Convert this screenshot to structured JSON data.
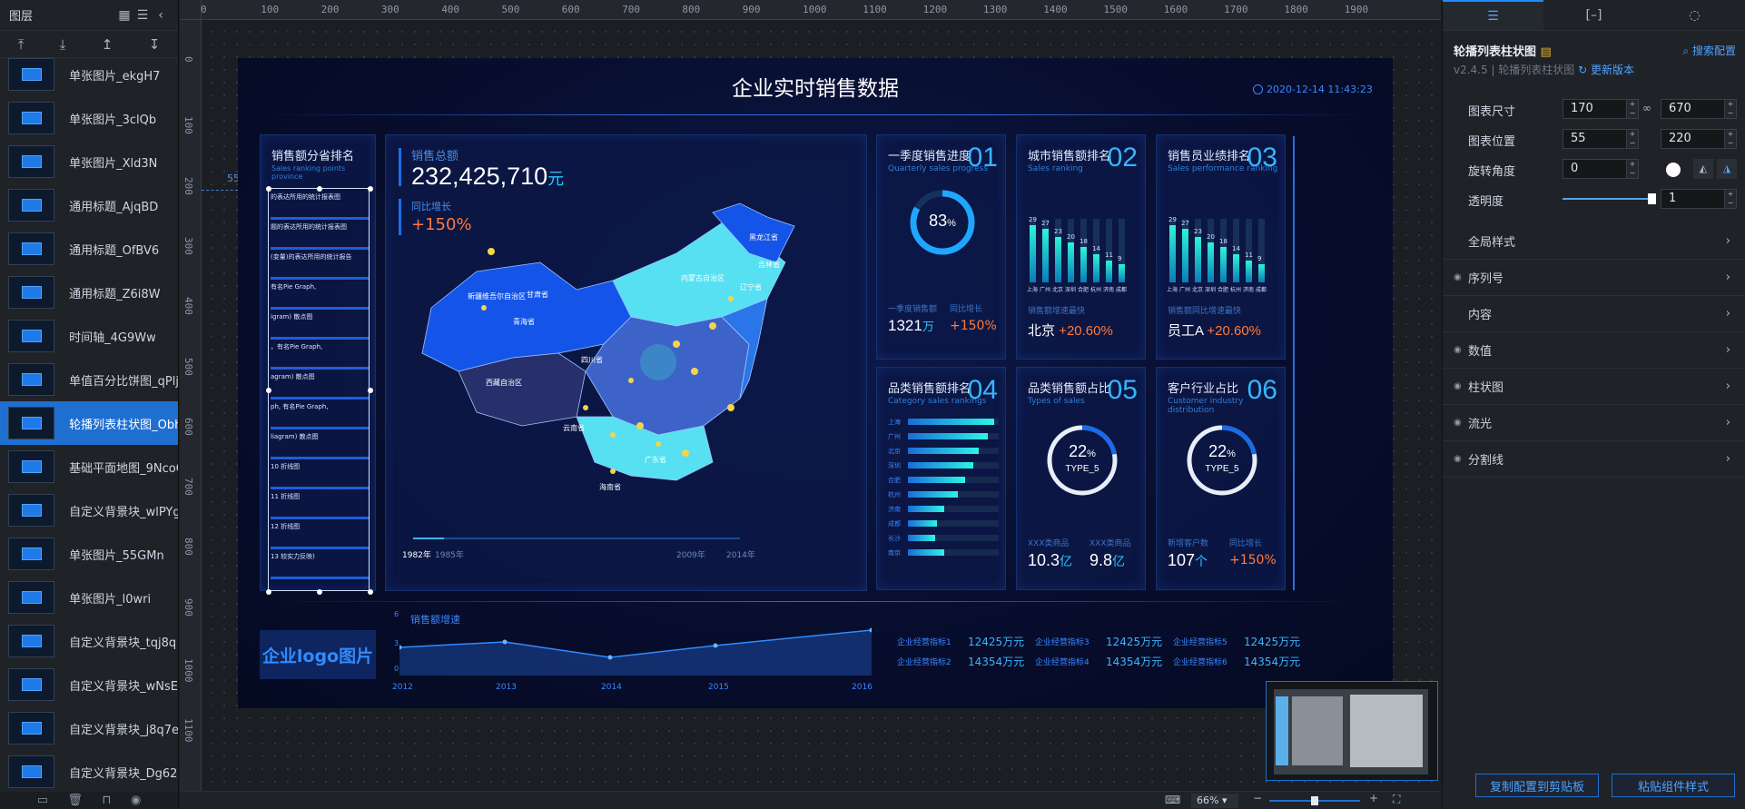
{
  "layers_panel": {
    "title": "图层",
    "items": [
      {
        "name": "单张图片_ekgH7"
      },
      {
        "name": "单张图片_3clQb"
      },
      {
        "name": "单张图片_Xld3N"
      },
      {
        "name": "通用标题_AjqBD"
      },
      {
        "name": "通用标题_OfBV6"
      },
      {
        "name": "通用标题_Z6i8W"
      },
      {
        "name": "时间轴_4G9Ww"
      },
      {
        "name": "单值百分比饼图_qPljX"
      },
      {
        "name": "轮播列表柱状图_Obhis"
      },
      {
        "name": "基础平面地图_9NcoO"
      },
      {
        "name": "自定义背景块_wlPYg"
      },
      {
        "name": "单张图片_55GMn"
      },
      {
        "name": "单张图片_l0wri"
      },
      {
        "name": "自定义背景块_tqj8q"
      },
      {
        "name": "自定义背景块_wNsE9"
      },
      {
        "name": "自定义背景块_j8q7e"
      },
      {
        "name": "自定义背景块_Dg62w"
      }
    ]
  },
  "ruler": {
    "h": [
      "0",
      "100",
      "200",
      "300",
      "400",
      "500",
      "600",
      "700",
      "800",
      "900",
      "1000",
      "1100",
      "1200",
      "1300",
      "1400",
      "1500",
      "1600",
      "1700",
      "1800",
      "1900"
    ],
    "v": [
      "0",
      "100",
      "200",
      "300",
      "400",
      "500",
      "600",
      "700",
      "800",
      "900",
      "1000",
      "1100"
    ],
    "pos_label": "55, 220"
  },
  "dashboard": {
    "title": "企业实时销售数据",
    "datetime": "2020-12-14 11:43:23",
    "rank": {
      "title": "销售额分省排名",
      "sub": "Sales ranking points province",
      "rows": [
        "的表达所用的统计报表图",
        "题的表达所用的统计报表图",
        "(变量)的表达所用的统计报告",
        "有名Pie Graph,",
        "igram)          散点图",
        "，有名Pie Graph,",
        "agram)          散点图",
        "ph, 有名Pie Graph,",
        "liagram)         散点图",
        "10    折线图",
        "11    折线图",
        "12    折线图",
        "13    较实力反映)"
      ]
    },
    "sales": {
      "label": "销售总额",
      "value": "232,425,710",
      "unit": "元",
      "growth_label": "同比增长",
      "growth": "+150%"
    },
    "map": {
      "timeline": [
        "1982年",
        "1985年",
        "2009年",
        "2014年"
      ],
      "regions": [
        "新疆维吾尔自治区",
        "甘肃省",
        "青海省",
        "西藏自治区",
        "内蒙古自治区",
        "黑龙江省",
        "吉林省",
        "辽宁省",
        "四川省",
        "云南省",
        "广东省",
        "海南省"
      ]
    },
    "c1": {
      "title": "一季度销售进度",
      "sub": "Quarterly sales progress",
      "num": "01",
      "pct": "83",
      "pct_unit": "%",
      "progress": 0.83,
      "s1_label": "一季度销售额",
      "s1_value": "1321",
      "s1_unit": "万",
      "s2_label": "同比增长",
      "s2_value": "+150%"
    },
    "c2": {
      "title": "城市销售额排名",
      "sub": "Sales ranking",
      "num": "02",
      "values": [
        "29",
        "27",
        "23",
        "20",
        "18",
        "14",
        "11",
        "9"
      ],
      "cats": [
        "上海",
        "广州",
        "北京",
        "深圳",
        "合肥",
        "杭州",
        "济南",
        "成都"
      ],
      "f_label": "销售额增速最快",
      "f_value": "北京",
      "f_pct": "+20.60%"
    },
    "c3": {
      "title": "销售员业绩排名",
      "sub": "Sales performance ranking",
      "num": "03",
      "values": [
        "29",
        "27",
        "23",
        "20",
        "18",
        "14",
        "11",
        "9"
      ],
      "cats": [
        "上海",
        "广州",
        "北京",
        "深圳",
        "合肥",
        "杭州",
        "济南",
        "成都"
      ],
      "f_label": "销售额同比增速最快",
      "f_value": "员工A",
      "f_pct": "+20.60%"
    },
    "c4": {
      "title": "品类销售额排名",
      "sub": "Category sales rankings",
      "num": "04",
      "cats": [
        "上海",
        "广州",
        "北京",
        "深圳",
        "合肥",
        "杭州",
        "济南",
        "成都",
        "长沙",
        "南京"
      ],
      "values": [
        0.95,
        0.88,
        0.78,
        0.72,
        0.63,
        0.55,
        0.4,
        0.32,
        0.3,
        0.4
      ]
    },
    "c5": {
      "title": "品类销售额占比",
      "sub": "Types of sales",
      "num": "05",
      "pct": "22",
      "pct_unit": "%",
      "type": "TYPE_5",
      "progress": 0.22,
      "s1_label": "XXX类商品",
      "s1_value": "10.3",
      "s1_unit": "亿",
      "s2_label": "XXX类商品",
      "s2_value": "9.8",
      "s2_unit": "亿"
    },
    "c6": {
      "title": "客户行业占比",
      "sub": "Customer industry distribution",
      "num": "06",
      "pct": "22",
      "pct_unit": "%",
      "type": "TYPE_5",
      "progress": 0.22,
      "s1_label": "新增客户数",
      "s1_value": "107",
      "s1_unit": "个",
      "s2_label": "同比增长",
      "s2_value": "+150%"
    },
    "logo": "企业logo图片",
    "line": {
      "title": "销售额增速",
      "years": [
        "2012",
        "2013",
        "2014",
        "2015",
        "2016"
      ],
      "y_ticks": [
        "6",
        "3",
        "0"
      ]
    },
    "bottom_list": [
      {
        "name": "企业经营指标1",
        "value": "12425万元"
      },
      {
        "name": "企业经营指标2",
        "value": "14354万元"
      },
      {
        "name": "企业经营指标3",
        "value": "12425万元"
      },
      {
        "name": "企业经营指标4",
        "value": "14354万元"
      },
      {
        "name": "企业经营指标5",
        "value": "12425万元"
      },
      {
        "name": "企业经营指标6",
        "value": "14354万元"
      }
    ]
  },
  "config": {
    "component_title": "轮播列表柱状图",
    "search": "搜索配置",
    "version": "v2.4.5 | 轮播列表柱状图",
    "update": "更新版本",
    "size_label": "图表尺寸",
    "width": "170",
    "height": "670",
    "pos_label": "图表位置",
    "x": "55",
    "y": "220",
    "rot_label": "旋转角度",
    "rotation": "0",
    "opacity_label": "透明度",
    "opacity": "1",
    "sections": [
      "全局样式",
      "序列号",
      "内容",
      "数值",
      "柱状图",
      "流光",
      "分割线"
    ],
    "copy_btn": "复制配置到剪贴板",
    "paste_btn": "粘贴组件样式"
  },
  "bottom_bar": {
    "zoom": "66%"
  }
}
